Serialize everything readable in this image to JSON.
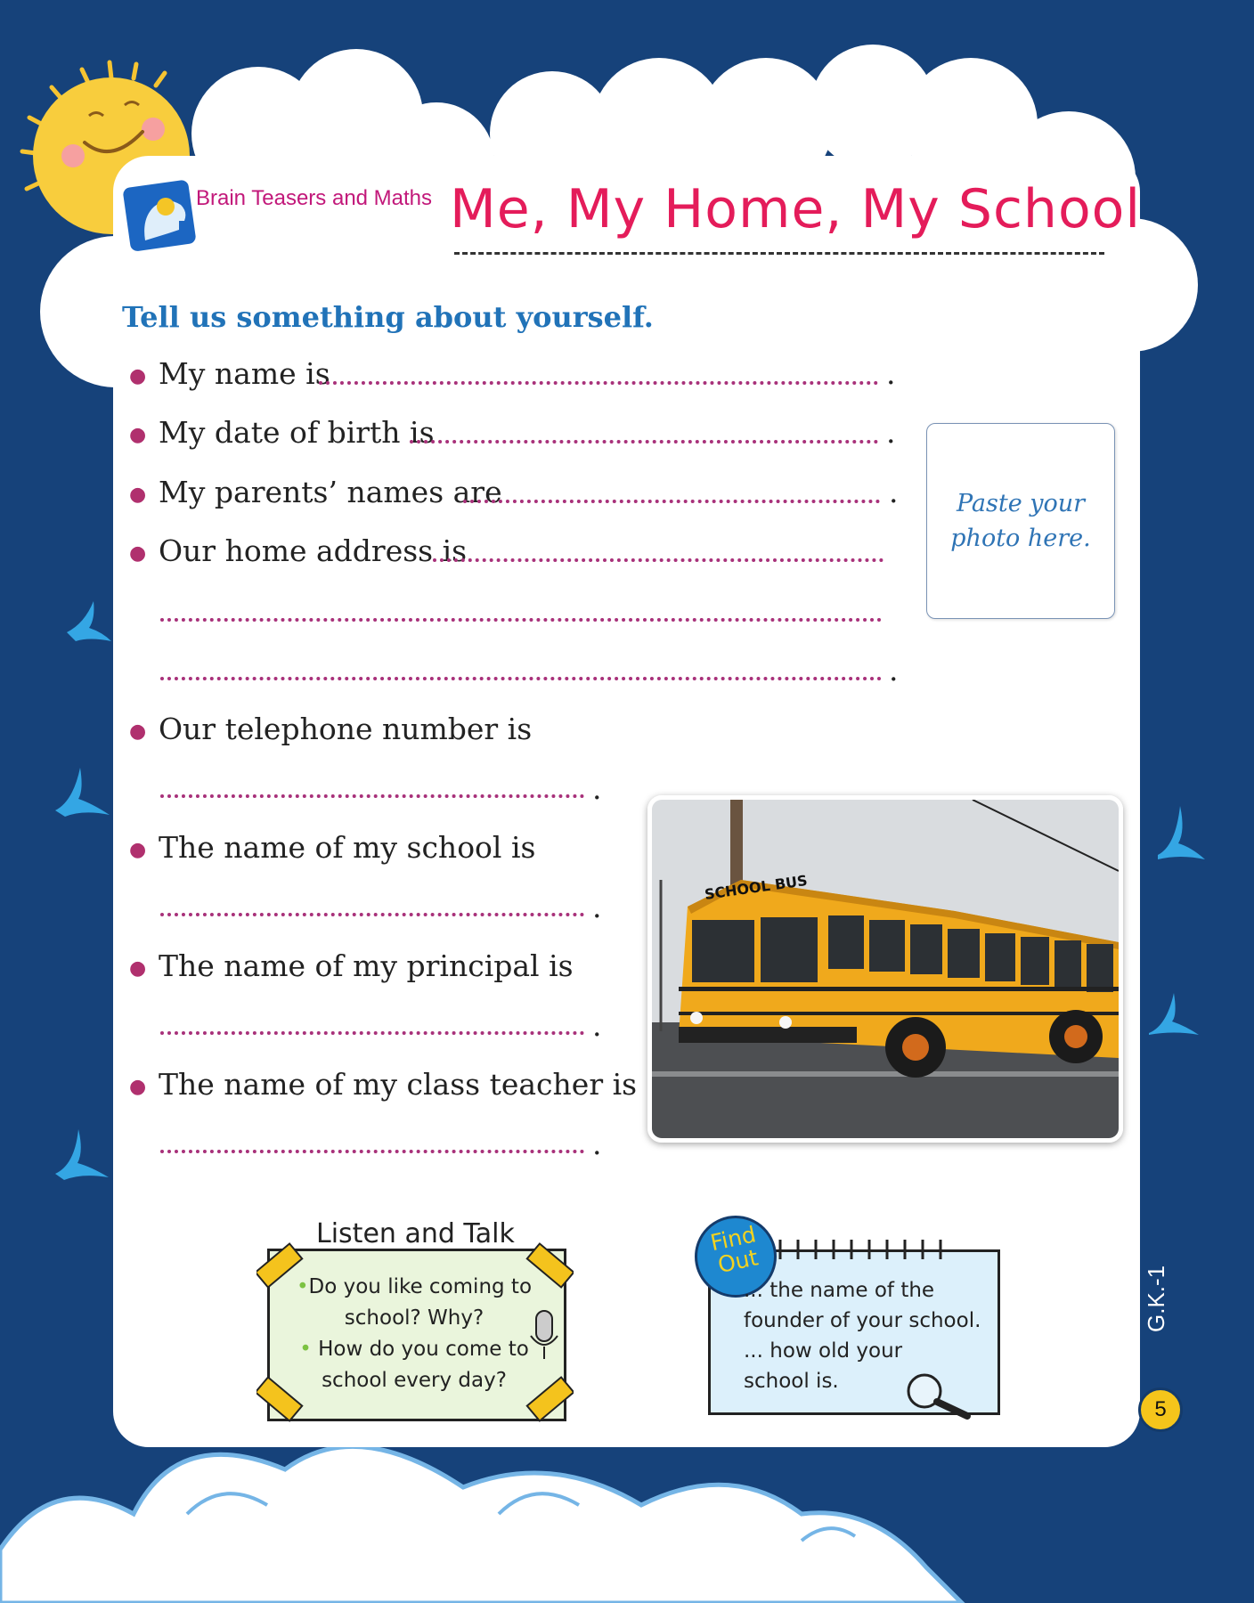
{
  "header": {
    "logo_text": "Brain Teasers and Maths",
    "title": "Me, My Home, My School"
  },
  "intro": "Tell us something about yourself.",
  "fields": [
    {
      "label": "My name is"
    },
    {
      "label": "My date of birth is"
    },
    {
      "label": "My parents’ names are"
    },
    {
      "label": "Our home address is"
    },
    {
      "label": "Our telephone number is"
    },
    {
      "label": "The name of my school is"
    },
    {
      "label": "The name of my principal is"
    },
    {
      "label": "The name of my class teacher is"
    }
  ],
  "photo_box": {
    "text": "Paste your photo here."
  },
  "bus_sign": "SCHOOL BUS",
  "listen_talk": {
    "title": "Listen and Talk",
    "q1": "Do you like coming to school? Why?",
    "q2": "How do you come to school every day?"
  },
  "find_out": {
    "badge": "Find Out",
    "item1": "... the name of the founder of your school.",
    "item2": "... how old your school is."
  },
  "footer": {
    "code": "G.K.-1",
    "page": "5"
  },
  "colors": {
    "background": "#16427a",
    "title": "#e41c5a",
    "intro": "#2173b8",
    "dots": "#a8317a"
  }
}
